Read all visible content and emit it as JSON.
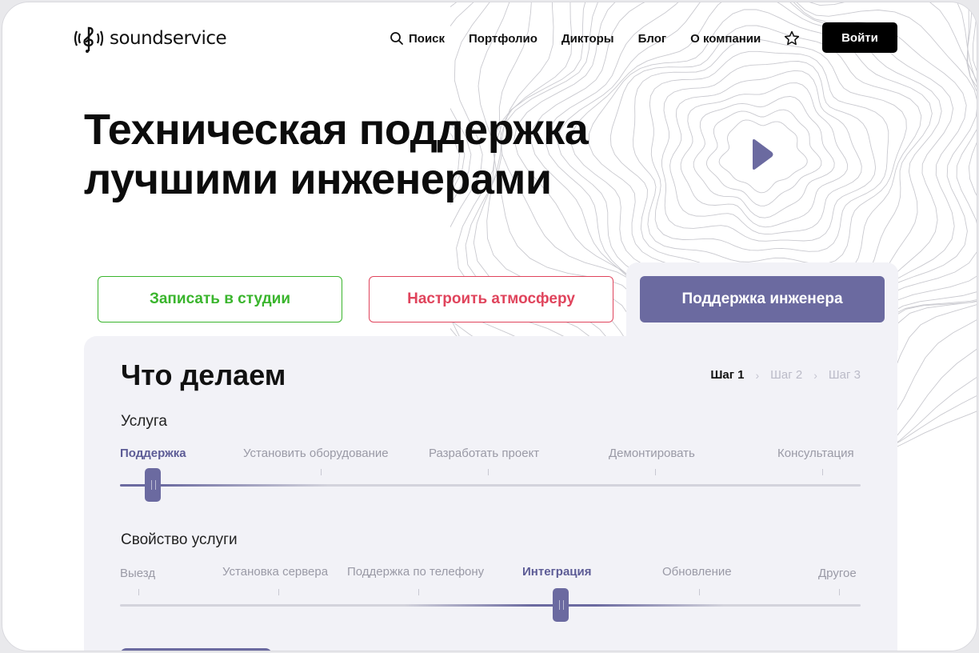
{
  "brand": {
    "name": "soundservice",
    "accent": "#6b6aa0",
    "green": "#3ab52d",
    "red": "#e0445c"
  },
  "nav": {
    "search_label": "Поиск",
    "portfolio_label": "Портфолио",
    "voices_label": "Дикторы",
    "blog_label": "Блог",
    "about_label": "О компании",
    "login_label": "Войти"
  },
  "hero": {
    "title_line1": "Техническая поддержка",
    "title_line2": "лучшими инженерами"
  },
  "tabs": {
    "record": "Записать в студии",
    "atmosphere": "Настроить атмосферу",
    "support": "Поддержка инженера"
  },
  "panel": {
    "title": "Что делаем",
    "steps": [
      "Шаг 1",
      "Шаг 2",
      "Шаг 3"
    ],
    "active_step": 1,
    "service": {
      "label": "Услуга",
      "options": [
        "Поддержка",
        "Установить оборудование",
        "Разработать проект",
        "Демонтировать",
        "Консультация"
      ],
      "selected": "Поддержка"
    },
    "property": {
      "label": "Свойство услуги",
      "options": [
        "Выезд",
        "Установка сервера",
        "Поддержка по телефону",
        "Интеграция",
        "Обновление",
        "Другое"
      ],
      "selected": "Интеграция"
    }
  }
}
